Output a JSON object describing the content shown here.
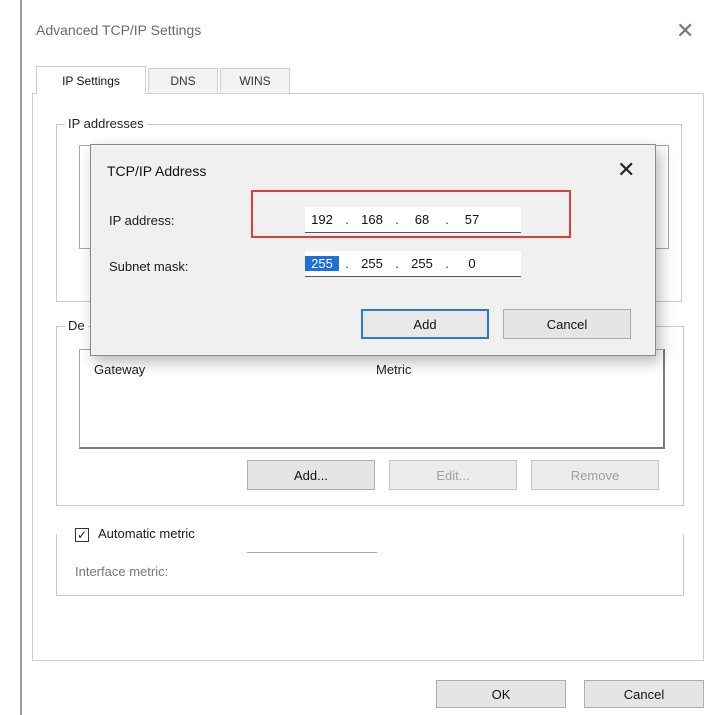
{
  "window": {
    "title": "Advanced TCP/IP Settings",
    "close_glyph": "✕"
  },
  "tabs": [
    {
      "label": "IP Settings",
      "active": true
    },
    {
      "label": "DNS",
      "active": false
    },
    {
      "label": "WINS",
      "active": false
    }
  ],
  "ip_addresses_group": {
    "label": "IP addresses"
  },
  "gateways_group": {
    "label": "De",
    "columns": [
      "Gateway",
      "Metric"
    ],
    "buttons": {
      "add": "Add...",
      "edit": "Edit...",
      "remove": "Remove"
    }
  },
  "metric_group": {
    "automatic_metric_label": "Automatic metric",
    "automatic_metric_checked": true,
    "check_glyph": "✓",
    "interface_metric_label": "Interface metric:",
    "interface_metric_value": ""
  },
  "footer": {
    "ok": "OK",
    "cancel": "Cancel"
  },
  "dialog": {
    "title": "TCP/IP Address",
    "close_glyph": "✕",
    "ip_label": "IP address:",
    "ip_octets": [
      "192",
      "168",
      "68",
      "57"
    ],
    "subnet_label": "Subnet mask:",
    "subnet_octets": [
      "255",
      "255",
      "255",
      "0"
    ],
    "separator": ".",
    "add": "Add",
    "cancel": "Cancel"
  },
  "colors": {
    "highlight_border": "#e33a3a",
    "selection": "#1e6fd9",
    "default_button_border": "#2a78d4"
  },
  "icons": {
    "close": "close-icon",
    "checkbox": "checkmark-icon"
  }
}
